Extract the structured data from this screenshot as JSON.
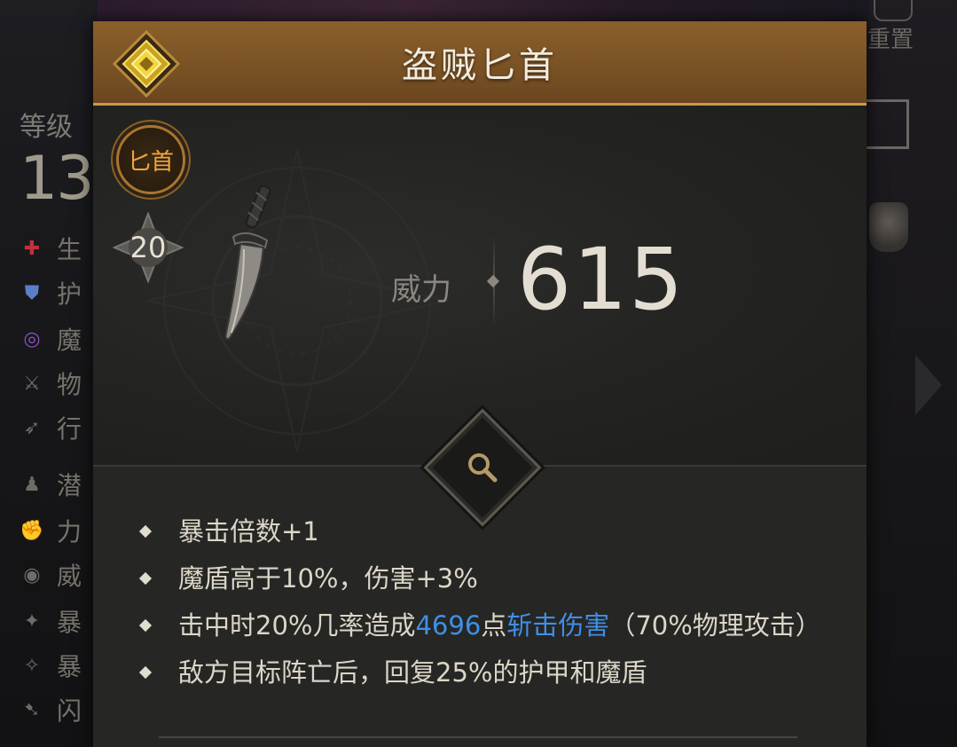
{
  "background": {
    "level_label": "等级",
    "level_value": "13",
    "reset_label": "重置",
    "stats": [
      {
        "label": "生",
        "icon": "health-cross-icon",
        "color": "#c2303a"
      },
      {
        "label": "护",
        "icon": "armor-shield-icon",
        "color": "#5a7fc8"
      },
      {
        "label": "魔",
        "icon": "magic-swirl-icon",
        "color": "#8a4fc2"
      },
      {
        "label": "物",
        "icon": "sword-icon",
        "color": "#6f6c68"
      },
      {
        "label": "行",
        "icon": "wing-icon",
        "color": "#6f6c68"
      },
      {
        "label": "潜",
        "icon": "stealth-figure-icon",
        "color": "#6f6c68"
      },
      {
        "label": "力",
        "icon": "fist-icon",
        "color": "#6f6c68"
      },
      {
        "label": "威",
        "icon": "target-icon",
        "color": "#6f6c68"
      },
      {
        "label": "暴",
        "icon": "crit-icon",
        "color": "#6f6c68"
      },
      {
        "label": "暴",
        "icon": "crit-damage-icon",
        "color": "#6f6c68"
      },
      {
        "label": "闪",
        "icon": "dodge-icon",
        "color": "#6f6c68"
      }
    ]
  },
  "item": {
    "name": "盗贼匕首",
    "type": "匕首",
    "level": "20",
    "power_label": "威力",
    "power_value": "615",
    "accent_color": "#f0a63a",
    "highlight_color": "#3f8fe6",
    "affixes": [
      {
        "parts": [
          {
            "text": "暴击倍数+1",
            "highlight": false
          }
        ]
      },
      {
        "parts": [
          {
            "text": "魔盾高于10%，伤害+3%",
            "highlight": false
          }
        ]
      },
      {
        "parts": [
          {
            "text": "击中时20%几率造成",
            "highlight": false
          },
          {
            "text": "4696",
            "highlight": true
          },
          {
            "text": "点",
            "highlight": false
          },
          {
            "text": "斩击伤害",
            "highlight": true
          },
          {
            "text": "（70%物理攻击）",
            "highlight": false
          }
        ]
      },
      {
        "parts": [
          {
            "text": "敌方目标阵亡后，回复25%的护甲和魔盾",
            "highlight": false
          }
        ]
      }
    ]
  }
}
